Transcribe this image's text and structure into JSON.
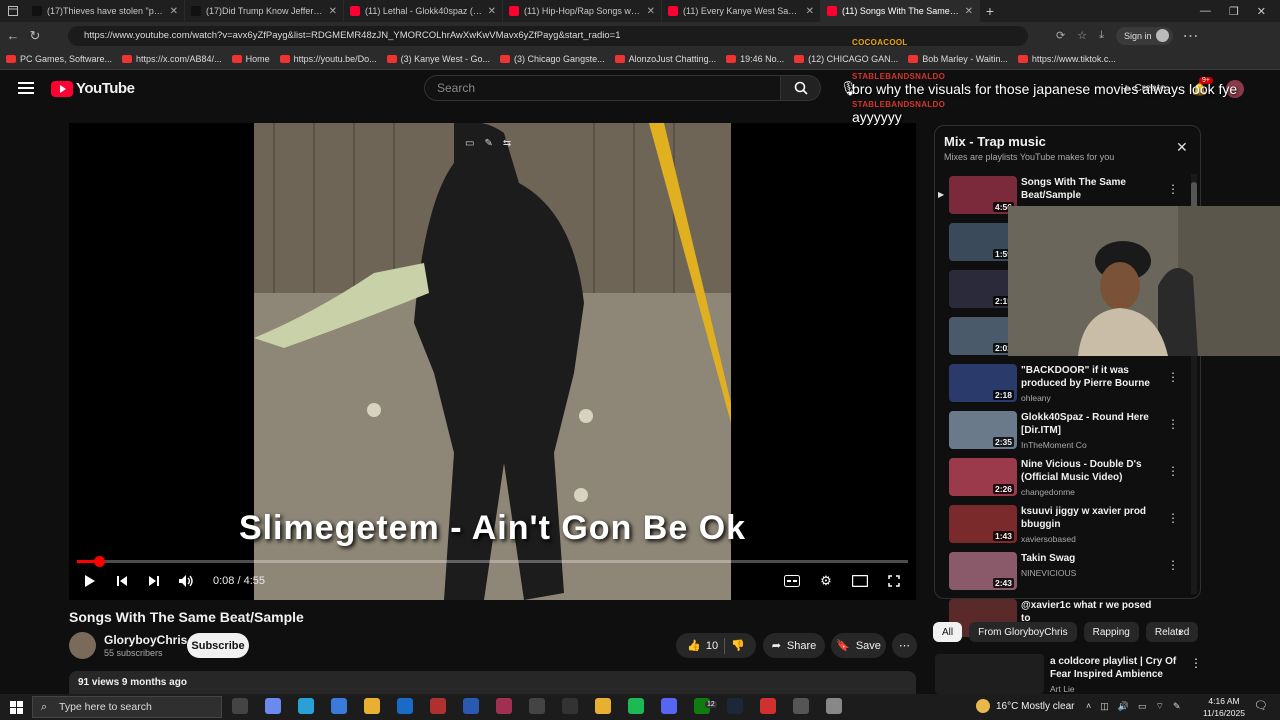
{
  "browser": {
    "tabs": [
      {
        "label": "(17)Thieves have stolen \"pricele...",
        "icon": "tiktok-icon",
        "color": "#111111"
      },
      {
        "label": "(17)Did Trump Know Jeffery Epst...",
        "icon": "tiktok-icon",
        "color": "#111111"
      },
      {
        "label": "(11) Lethal - Glokk40spaz (old ve...",
        "icon": "youtube-icon",
        "color": "#ff0033"
      },
      {
        "label": "(11) Hip-Hop/Rap Songs with Vid...",
        "icon": "youtube-icon",
        "color": "#ff0033"
      },
      {
        "label": "(11) Every Kanye West Sample EV...",
        "icon": "youtube-icon",
        "color": "#ff0033"
      },
      {
        "label": "(11) Songs With The Same B...",
        "icon": "youtube-icon",
        "color": "#ff0033",
        "active": true
      }
    ],
    "url": "https://www.youtube.com/watch?v=avx6yZfPayg&list=RDGMEMR48zJN_YMORCOLhrAwXwKwVMavx6yZfPayg&start_radio=1",
    "sign_in": "Sign in",
    "bookmarks": [
      "PC Games, Software...",
      "https://x.com/AB84/...",
      "Home",
      "https://youtu.be/Do...",
      "(3) Kanye West - Go...",
      "(3) Chicago Gangste...",
      "AlonzoJust Chatting...",
      "19:46 No...",
      "(12) CHICAGO GAN...",
      "Bob Marley - Waitin...",
      "https://www.tiktok.c..."
    ]
  },
  "youtube": {
    "logo_text": "YouTube",
    "search_placeholder": "Search",
    "create_label": "Create",
    "notif_count": "9+"
  },
  "player": {
    "overlay_title": "Slimegetem - Ain't Gon Be Ok",
    "time": "0:08 / 4:55",
    "progress_fraction": 0.027
  },
  "video": {
    "title": "Songs With The Same Beat/Sample",
    "channel": "GloryboyChris",
    "subscribers": "55 subscribers",
    "subscribe_label": "Subscribe",
    "likes": "10",
    "share_label": "Share",
    "save_label": "Save",
    "meta": "91 views  9 months ago"
  },
  "mix": {
    "title": "Mix - Trap music",
    "subtitle": "Mixes are playlists YouTube makes for you",
    "items": [
      {
        "title": "Songs With The Same Beat/Sample",
        "channel": "",
        "duration": "4:56",
        "color": "#7a2a3a",
        "playing": true
      },
      {
        "title": "",
        "channel": "",
        "duration": "1:59",
        "color": "#3a4a5a"
      },
      {
        "title": "",
        "channel": "",
        "duration": "2:15",
        "color": "#2a2a3a"
      },
      {
        "title": "",
        "channel": "",
        "duration": "2:02",
        "color": "#4a5a6a"
      },
      {
        "title": "\"BACKDOOR\" if it was produced by Pierre Bourne",
        "channel": "ohleany",
        "duration": "2:18",
        "color": "#2a3a6a"
      },
      {
        "title": "Glokk40Spaz - Round Here [Dir.ITM]",
        "channel": "InTheMoment Co",
        "duration": "2:35",
        "color": "#6a7a8a"
      },
      {
        "title": "Nine Vicious - Double D's (Official Music Video)",
        "channel": "changedonme",
        "duration": "2:26",
        "color": "#9a3a4a"
      },
      {
        "title": "ksuuvi jiggy w xavier prod bbuggin",
        "channel": "xaviersobased",
        "duration": "1:43",
        "color": "#7a2a2a"
      },
      {
        "title": "Takin Swag",
        "channel": "NINEVICIOUS",
        "duration": "2:43",
        "color": "#8a5a6a"
      },
      {
        "title": "@xavier1c what r we posed to",
        "channel": "",
        "duration": "",
        "color": "#5a2a2a"
      }
    ]
  },
  "chips": [
    "All",
    "From GloryboyChris",
    "Rapping",
    "Related"
  ],
  "recommended": {
    "title": "a coldcore playlist | Cry Of Fear Inspired Ambience",
    "channel": "Art Lie"
  },
  "chat": [
    {
      "name": "COCOACOOL",
      "message": "",
      "color": "#e8a317"
    },
    {
      "name": "STABLEBANDSNALDO",
      "message": "bro why the visuals for those japanese movies always look fye",
      "color": "#d4342c"
    },
    {
      "name": "STABLEBANDSNALDO",
      "message": "ayyyyyy",
      "color": "#d4342c"
    }
  ],
  "taskbar": {
    "search_placeholder": "Type here to search",
    "weather": "16°C  Mostly clear",
    "time": "4:16 AM",
    "date": "11/16/2025",
    "badge": "12"
  }
}
